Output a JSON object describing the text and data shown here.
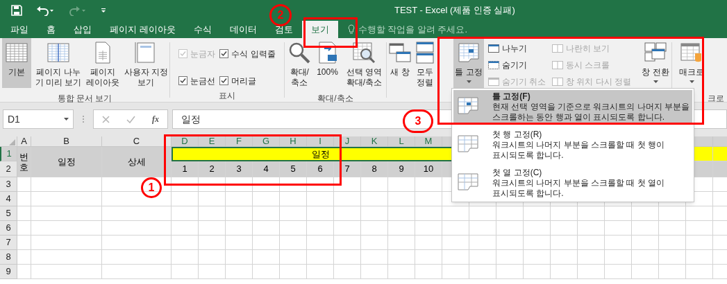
{
  "quick_access": [
    {
      "kind": "save",
      "disabled": false
    },
    {
      "kind": "undo",
      "disabled": false
    },
    {
      "kind": "redo",
      "disabled": true
    },
    {
      "kind": "customize",
      "disabled": false
    }
  ],
  "window": {
    "title": "TEST - Excel (제품 인증 실패)"
  },
  "tabs": [
    {
      "label": "파일",
      "selected": false
    },
    {
      "label": "홈",
      "selected": false
    },
    {
      "label": "삽입",
      "selected": false
    },
    {
      "label": "페이지 레이아웃",
      "selected": false
    },
    {
      "label": "수식",
      "selected": false
    },
    {
      "label": "데이터",
      "selected": false
    },
    {
      "label": "검토",
      "selected": false
    },
    {
      "label": "보기",
      "selected": true
    }
  ],
  "tell_me": {
    "placeholder": "수행할 작업을 알려 주세요."
  },
  "ribbon": {
    "workbook_views": {
      "label": "통합 문서 보기",
      "buttons": [
        {
          "lines": [
            "기본"
          ],
          "selected": true
        },
        {
          "lines": [
            "페이지 나누",
            "기 미리 보기"
          ],
          "selected": false
        },
        {
          "lines": [
            "페이지",
            "레이아웃"
          ],
          "selected": false
        },
        {
          "lines": [
            "사용자 지정",
            "보기"
          ],
          "selected": false
        }
      ]
    },
    "show": {
      "label": "표시",
      "options": [
        {
          "label": "눈금자",
          "checked": true,
          "disabled": true
        },
        {
          "label": "눈금선",
          "checked": true,
          "disabled": false
        },
        {
          "label": "수식 입력줄",
          "checked": true,
          "disabled": false
        },
        {
          "label": "머리글",
          "checked": true,
          "disabled": false
        }
      ]
    },
    "zoom": {
      "label": "확대/축소",
      "buttons": [
        {
          "lines": [
            "확대/",
            "축소"
          ]
        },
        {
          "lines": [
            "100%"
          ]
        },
        {
          "lines": [
            "선택 영역",
            "확대/축소"
          ]
        }
      ]
    },
    "window": {
      "large_buttons": [
        {
          "lines": [
            "새 창"
          ],
          "expanded": false,
          "dropdown": false
        },
        {
          "lines": [
            "모두",
            "정렬"
          ],
          "expanded": false,
          "dropdown": false
        },
        {
          "lines": [
            "틀 고정"
          ],
          "expanded": true,
          "dropdown": true
        }
      ],
      "small_buttons": [
        {
          "label": "나누기",
          "disabled": false
        },
        {
          "label": "숨기기",
          "disabled": false
        },
        {
          "label": "숨기기 취소",
          "disabled": true
        },
        {
          "label": "나란히 보기",
          "disabled": true
        },
        {
          "label": "동시 스크롤",
          "disabled": true
        },
        {
          "label": "창 위치 다시 정렬",
          "disabled": true
        }
      ],
      "switch_button": {
        "lines": [
          "창 전환"
        ],
        "dropdown": true
      }
    },
    "macros": {
      "label": "크로",
      "button": {
        "lines": [
          "매크로"
        ],
        "dropdown": true
      }
    }
  },
  "name_box": {
    "value": "D1"
  },
  "formula_bar": {
    "function_label": "fx",
    "value": "일정"
  },
  "sheet": {
    "columns": [
      {
        "label": "A",
        "selected": false
      },
      {
        "label": "B",
        "selected": false
      },
      {
        "label": "C",
        "selected": false
      },
      {
        "label": "D",
        "selected": true
      },
      {
        "label": "E",
        "selected": true
      },
      {
        "label": "F",
        "selected": true
      },
      {
        "label": "G",
        "selected": true
      },
      {
        "label": "H",
        "selected": true
      },
      {
        "label": "I",
        "selected": true
      },
      {
        "label": "J",
        "selected": true
      },
      {
        "label": "K",
        "selected": true
      },
      {
        "label": "L",
        "selected": true
      },
      {
        "label": "M",
        "selected": true
      }
    ],
    "rows": [
      {
        "label": "1",
        "selected": true
      },
      {
        "label": "2",
        "selected": false
      },
      {
        "label": "3",
        "selected": false
      },
      {
        "label": "4",
        "selected": false
      },
      {
        "label": "5",
        "selected": false
      },
      {
        "label": "6",
        "selected": false
      },
      {
        "label": "7",
        "selected": false
      },
      {
        "label": "8",
        "selected": false
      },
      {
        "label": "9",
        "selected": false
      }
    ],
    "header_cells": [
      "번호",
      "일정",
      "상세"
    ],
    "banner": "일정",
    "days": [
      "1",
      "2",
      "3",
      "4",
      "5",
      "6",
      "7",
      "8",
      "9",
      "10"
    ]
  },
  "freeze_menu": {
    "items": [
      {
        "title": "틀 고정(F)",
        "lines": [
          "현재 선택 영역을 기준으로 워크시트의 나머지 부분을",
          "스크롤하는 동안 행과 열이 표시되도록 합니다."
        ],
        "selected": true
      },
      {
        "title": "첫 행 고정(R)",
        "lines": [
          "워크시트의 나머지 부분을 스크롤할 때 첫 행이",
          "표시되도록 합니다."
        ],
        "selected": false
      },
      {
        "title": "첫 열 고정(C)",
        "lines": [
          "워크시트의 나머지 부분을 스크롤할 때 첫 열이",
          "표시되도록 합니다."
        ],
        "selected": false
      }
    ]
  },
  "annotations": [
    {
      "label": "1"
    },
    {
      "label": "2"
    },
    {
      "label": "3"
    }
  ]
}
